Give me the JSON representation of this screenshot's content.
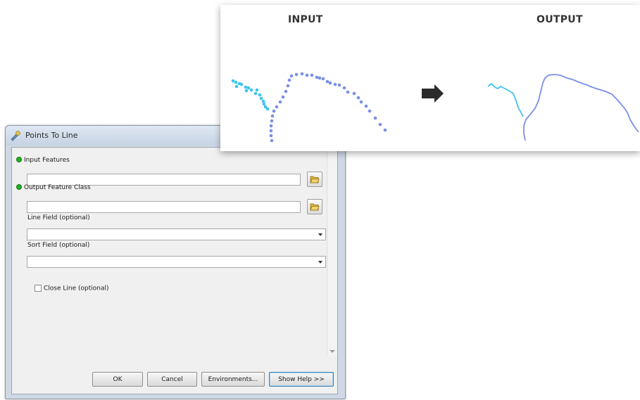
{
  "dialog": {
    "title": "Points To Line",
    "params": {
      "input_features": "Input Features",
      "output_feature_class": "Output Feature Class",
      "line_field": "Line Field (optional)",
      "sort_field": "Sort Field (optional)",
      "close_line": "Close Line (optional)"
    },
    "values": {
      "input_features": "",
      "output_feature_class": "",
      "line_field": "",
      "sort_field": ""
    },
    "close_line_checked": false,
    "buttons": {
      "ok": "OK",
      "cancel": "Cancel",
      "environments": "Environments...",
      "show_help": "Show Help >>"
    }
  },
  "diagram": {
    "input_heading": "INPUT",
    "output_heading": "OUTPUT",
    "colors": {
      "series_a": "#3fc3ee",
      "series_b": "#7b8fe6",
      "arrow": "#2b2b2b"
    },
    "arrow_icon": "right-arrow-icon"
  }
}
